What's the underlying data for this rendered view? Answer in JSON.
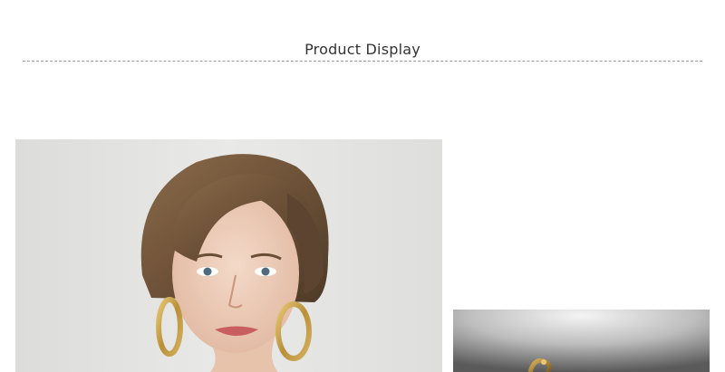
{
  "header": {
    "title": "Product Display"
  },
  "images": {
    "model_photo": "model-wearing-gold-hoop-earrings",
    "product_photo": "gold-hoop-earring-product-shot"
  },
  "colors": {
    "background": "#ffffff",
    "title_text": "#333333",
    "divider": "#9a9a9a",
    "gold": "#c9a24a"
  }
}
